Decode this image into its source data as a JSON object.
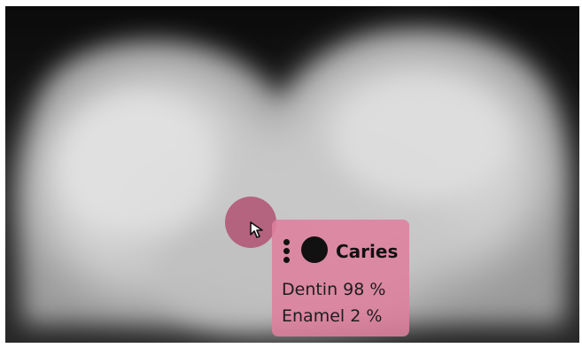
{
  "finding": {
    "title": "Caries",
    "rows": [
      "Dentin 98 %",
      "Enamel 2 %"
    ],
    "icon": "circle-icon",
    "menu_icon": "more-vertical-icon"
  },
  "colors": {
    "overlay": "#b04e6e",
    "card": "#de809e"
  }
}
